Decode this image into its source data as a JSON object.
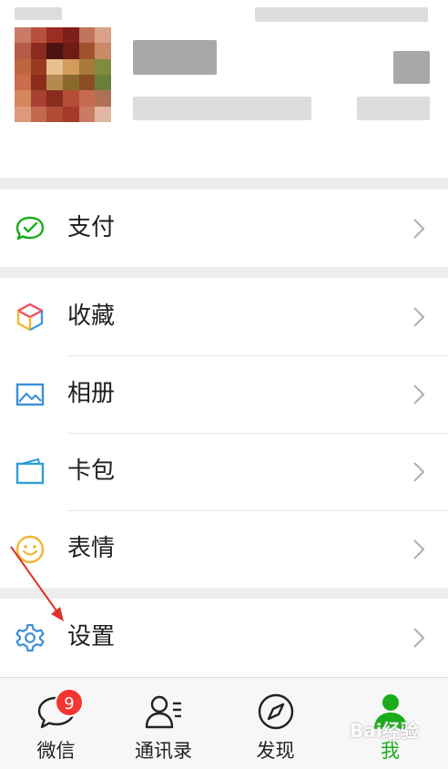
{
  "colors": {
    "accent": "#1aad19",
    "badge": "#f43530",
    "background": "#ededed"
  },
  "menu": {
    "pay": {
      "label": "支付",
      "icon": "wallet-check-icon"
    },
    "favorites": {
      "label": "收藏",
      "icon": "cube-icon"
    },
    "album": {
      "label": "相册",
      "icon": "photo-icon"
    },
    "cards": {
      "label": "卡包",
      "icon": "card-wallet-icon"
    },
    "stickers": {
      "label": "表情",
      "icon": "smile-icon"
    },
    "settings": {
      "label": "设置",
      "icon": "gear-icon"
    }
  },
  "tabbar": {
    "chats": {
      "label": "微信",
      "badge": "9",
      "icon": "chat-bubble-icon"
    },
    "contacts": {
      "label": "通讯录",
      "icon": "contacts-icon"
    },
    "discover": {
      "label": "发现",
      "icon": "compass-icon"
    },
    "me": {
      "label": "我",
      "icon": "person-icon",
      "active": true
    }
  },
  "watermark": "Bai经验"
}
